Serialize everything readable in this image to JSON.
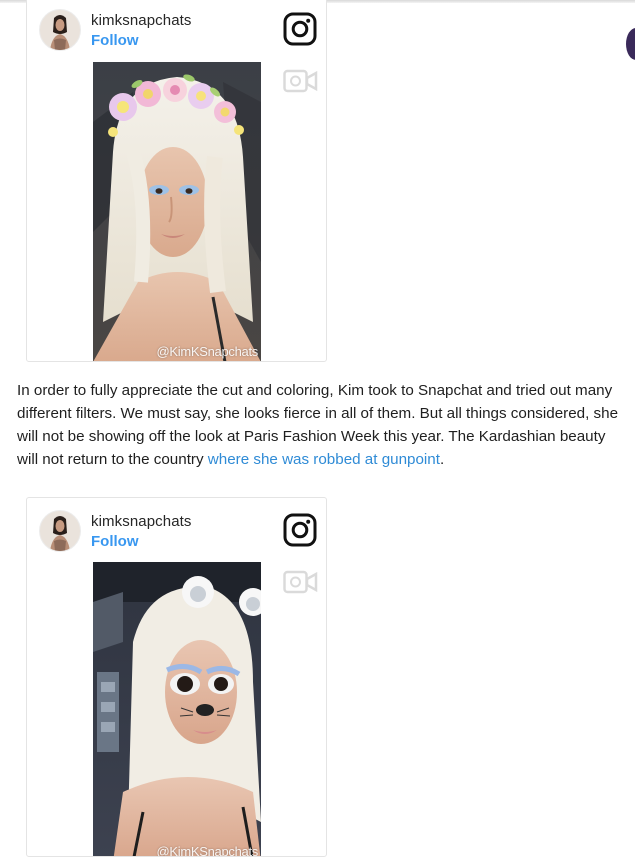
{
  "posts": [
    {
      "username": "kimksnapchats",
      "follow_label": "Follow",
      "watermark": "@KimKSnapchats",
      "photo_subject": "selfie with flower-crown filter, platinum blonde hair"
    },
    {
      "username": "kimksnapchats",
      "follow_label": "Follow",
      "watermark": "@KimKSnapchats",
      "photo_subject": "selfie with bear-ears filter, platinum blonde hair"
    }
  ],
  "article": {
    "paragraph_text": "In order to fully appreciate the cut and coloring, Kim took to Snapchat and tried out many different filters. We must say, she looks fierce in all of them. But all things considered, she will not be showing off the look at Paris Fashion Week this year. The Kardashian beauty will not return to the country ",
    "link_text": "where she was robbed at gunpoint",
    "paragraph_end": "."
  },
  "icons": {
    "instagram": "instagram-icon",
    "video": "video-camera-icon",
    "avatar": "avatar"
  },
  "colors": {
    "link": "#2f8bd6",
    "follow": "#3897f0",
    "text": "#1f1f1f"
  }
}
